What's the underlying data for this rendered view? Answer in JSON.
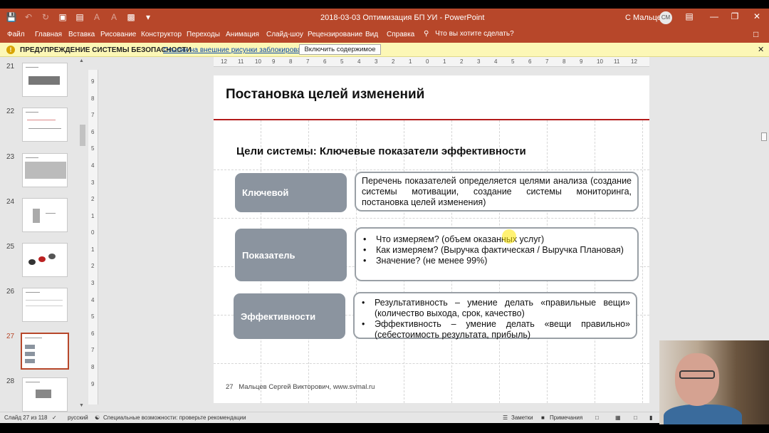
{
  "titlebar": {
    "document_title": "2018-03-03 Оптимизация БП УИ  -  PowerPoint",
    "user_name": "С Мальцев",
    "avatar_initials": "СМ"
  },
  "ribbon_tabs": [
    "Файл",
    "Главная",
    "Вставка",
    "Рисование",
    "Конструктор",
    "Переходы",
    "Анимация",
    "Слайд-шоу",
    "Рецензирование",
    "Вид",
    "Справка"
  ],
  "tell_me": "Что вы хотите сделать?",
  "message_bar": {
    "title": "ПРЕДУПРЕЖДЕНИЕ СИСТЕМЫ БЕЗОПАСНОСТИ",
    "text": "Ссылки на внешние рисунки заблокированы",
    "button": "Включить содержимое"
  },
  "thumbnails": [
    {
      "number": "21"
    },
    {
      "number": "22"
    },
    {
      "number": "23"
    },
    {
      "number": "24"
    },
    {
      "number": "25"
    },
    {
      "number": "26"
    },
    {
      "number": "27"
    },
    {
      "number": "28"
    }
  ],
  "slide": {
    "title": "Постановка целей изменений",
    "subtitle": "Цели системы: Ключевые показатели эффективности",
    "rows": [
      {
        "label": "Ключевой",
        "text": "Перечень показателей определяется целями анализа (создание системы мотивации, создание системы мониторинга, постановка целей изменения)"
      },
      {
        "label": "Показатель",
        "bullets": [
          "Что измеряем? (объем оказанных услуг)",
          "Как измеряем? (Выручка фактическая / Выручка Плановая)",
          "Значение? (не менее 99%)"
        ]
      },
      {
        "label": "Эффективности",
        "bullets": [
          "Результативность – умение делать «правильные вещи» (количество выхода, срок, качество)",
          "Эффективность – умение делать «вещи правильно» (себестоимость результата, прибыль)"
        ]
      }
    ],
    "footer_number": "27",
    "footer_text": "Мальцев Сергей Викторович, www.svmal.ru"
  },
  "statusbar": {
    "slide_info": "Слайд 27 из 118",
    "language": "русский",
    "accessibility": "Специальные возможности: проверьте рекомендации",
    "notes": "Заметки",
    "comments": "Примечания"
  },
  "ruler_top_labels": [
    "12",
    "11",
    "10",
    "9",
    "8",
    "7",
    "6",
    "5",
    "4",
    "3",
    "2",
    "1",
    "0",
    "1",
    "2",
    "3",
    "4",
    "5",
    "6",
    "7",
    "8",
    "9",
    "10",
    "11",
    "12"
  ],
  "ruler_left_labels": [
    "9",
    "8",
    "7",
    "6",
    "5",
    "4",
    "3",
    "2",
    "1",
    "0",
    "1",
    "2",
    "3",
    "4",
    "5",
    "6",
    "7",
    "8",
    "9"
  ],
  "colors": {
    "accent": "#b7472a",
    "title_line": "#b31b1b",
    "label_box": "#8b949f"
  }
}
